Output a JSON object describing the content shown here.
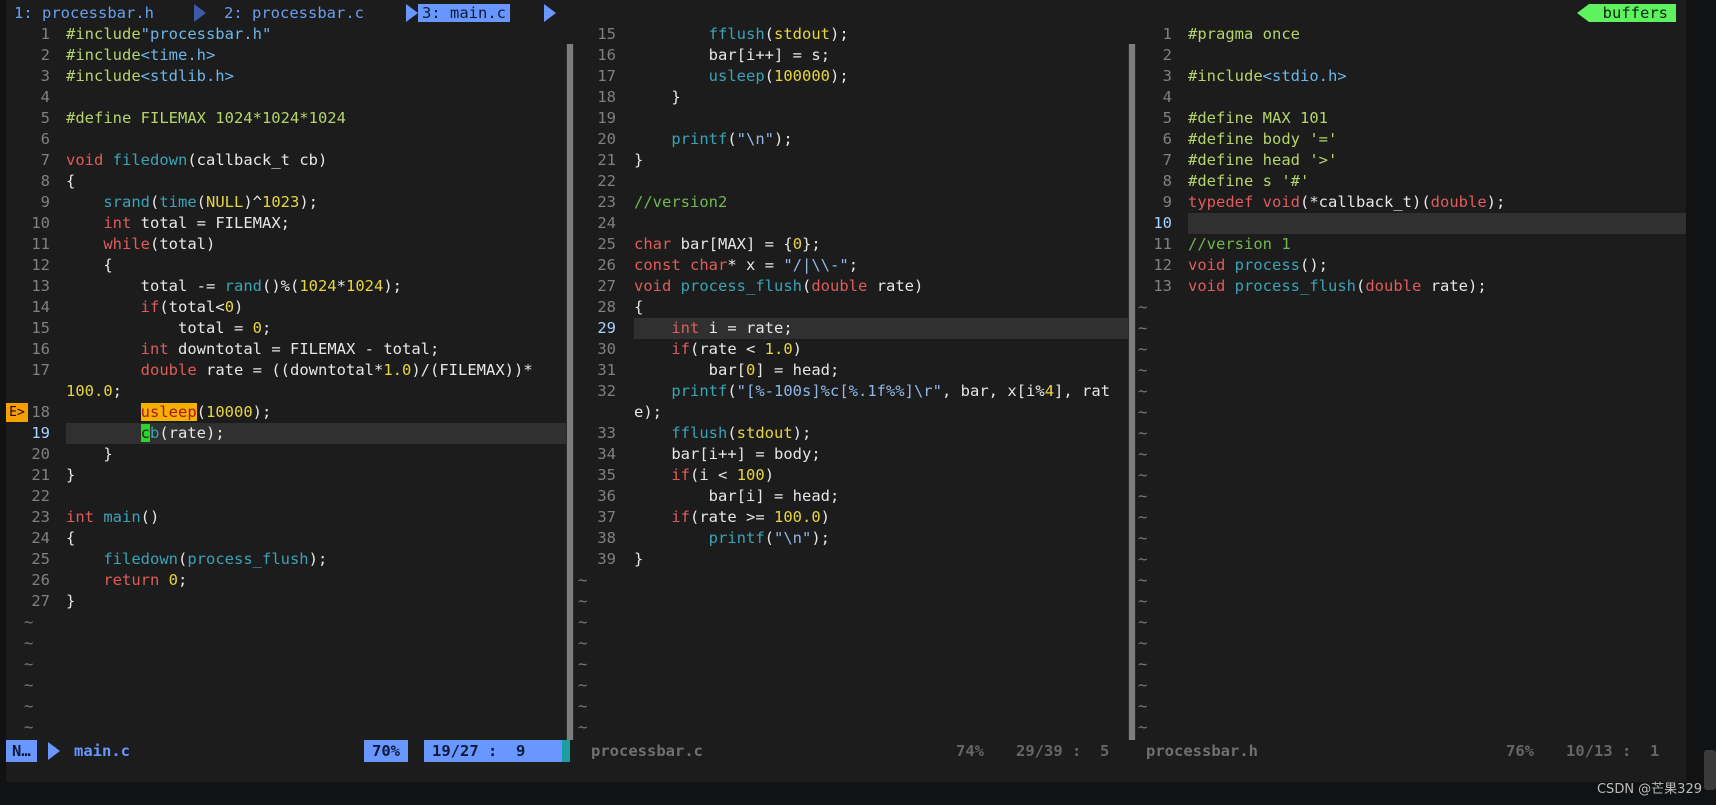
{
  "tabline": {
    "tabs": [
      "1: processbar.h",
      "2: processbar.c",
      "3: main.c"
    ],
    "right": "buffers"
  },
  "panes": [
    {
      "file": "main.c",
      "lines": [
        {
          "n": "1",
          "t": "#include\"processbar.h\""
        },
        {
          "n": "2",
          "t": "#include<time.h>"
        },
        {
          "n": "3",
          "t": "#include<stdlib.h>"
        },
        {
          "n": "4",
          "t": ""
        },
        {
          "n": "5",
          "t": "#define FILEMAX 1024*1024*1024"
        },
        {
          "n": "6",
          "t": ""
        },
        {
          "n": "7",
          "t": "void filedown(callback_t cb)"
        },
        {
          "n": "8",
          "t": "{"
        },
        {
          "n": "9",
          "t": "    srand(time(NULL)^1023);"
        },
        {
          "n": "10",
          "t": "    int total = FILEMAX;"
        },
        {
          "n": "11",
          "t": "    while(total)"
        },
        {
          "n": "12",
          "t": "    {"
        },
        {
          "n": "13",
          "t": "        total -= rand()%(1024*1024);"
        },
        {
          "n": "14",
          "t": "        if(total<0)"
        },
        {
          "n": "15",
          "t": "            total = 0;"
        },
        {
          "n": "16",
          "t": "        int downtotal = FILEMAX - total;"
        },
        {
          "n": "17",
          "t": "        double rate = ((downtotal*1.0)/(FILEMAX))*"
        },
        {
          "n": "",
          "t": "100.0;"
        },
        {
          "n": "18",
          "t": "        usleep(10000);"
        },
        {
          "n": "19",
          "t": "        cb(rate);"
        },
        {
          "n": "20",
          "t": "    }"
        },
        {
          "n": "21",
          "t": "}"
        },
        {
          "n": "22",
          "t": ""
        },
        {
          "n": "23",
          "t": "int main()"
        },
        {
          "n": "24",
          "t": "{"
        },
        {
          "n": "25",
          "t": "    filedown(process_flush);"
        },
        {
          "n": "26",
          "t": "    return 0;"
        },
        {
          "n": "27",
          "t": "}"
        }
      ],
      "tildes": 6,
      "sign": "E>"
    },
    {
      "file": "processbar.c",
      "lines": [
        {
          "n": "15",
          "t": "        fflush(stdout);"
        },
        {
          "n": "16",
          "t": "        bar[i++] = s;"
        },
        {
          "n": "17",
          "t": "        usleep(100000);"
        },
        {
          "n": "18",
          "t": "    }"
        },
        {
          "n": "19",
          "t": ""
        },
        {
          "n": "20",
          "t": "    printf(\"\\n\");"
        },
        {
          "n": "21",
          "t": "}"
        },
        {
          "n": "22",
          "t": ""
        },
        {
          "n": "23",
          "t": "//version2"
        },
        {
          "n": "24",
          "t": ""
        },
        {
          "n": "25",
          "t": "char bar[MAX] = {0};"
        },
        {
          "n": "26",
          "t": "const char* x = \"/|\\\\-\";"
        },
        {
          "n": "27",
          "t": "void process_flush(double rate)"
        },
        {
          "n": "28",
          "t": "{"
        },
        {
          "n": "29",
          "t": "    int i = rate;"
        },
        {
          "n": "30",
          "t": "    if(rate < 1.0)"
        },
        {
          "n": "31",
          "t": "        bar[0] = head;"
        },
        {
          "n": "32",
          "t": "    printf(\"[%-100s]%c[%.1f%%]\\r\", bar, x[i%4], rat"
        },
        {
          "n": "",
          "t": "e);"
        },
        {
          "n": "33",
          "t": "    fflush(stdout);"
        },
        {
          "n": "34",
          "t": "    bar[i++] = body;"
        },
        {
          "n": "35",
          "t": "    if(i < 100)"
        },
        {
          "n": "36",
          "t": "        bar[i] = head;"
        },
        {
          "n": "37",
          "t": "    if(rate >= 100.0)"
        },
        {
          "n": "38",
          "t": "        printf(\"\\n\");"
        },
        {
          "n": "39",
          "t": "}"
        }
      ],
      "tildes": 8
    },
    {
      "file": "processbar.h",
      "lines": [
        {
          "n": "1",
          "t": "#pragma once"
        },
        {
          "n": "2",
          "t": ""
        },
        {
          "n": "3",
          "t": "#include<stdio.h>"
        },
        {
          "n": "4",
          "t": ""
        },
        {
          "n": "5",
          "t": "#define MAX 101"
        },
        {
          "n": "6",
          "t": "#define body '='"
        },
        {
          "n": "7",
          "t": "#define head '>'"
        },
        {
          "n": "8",
          "t": "#define s '#'"
        },
        {
          "n": "9",
          "t": "typedef void(*callback_t)(double);"
        },
        {
          "n": "10",
          "t": ""
        },
        {
          "n": "11",
          "t": "//version 1"
        },
        {
          "n": "12",
          "t": "void process();"
        },
        {
          "n": "13",
          "t": "void process_flush(double rate);"
        }
      ],
      "tildes": 21
    }
  ],
  "status": {
    "mode": "N…",
    "file1": "main.c",
    "pct1": "70%",
    "pos1": "19/27 :  9",
    "file2": "processbar.c",
    "pct2": "74%",
    "pos2": "29/39 :  5",
    "file3": "processbar.h",
    "pct3": "76%",
    "pos3": "10/13 :  1"
  },
  "watermark": "CSDN @芒果329",
  "colors": {
    "accent": "#6a96ff",
    "buffers": "#5ef25e",
    "warn": "#f3b200"
  }
}
